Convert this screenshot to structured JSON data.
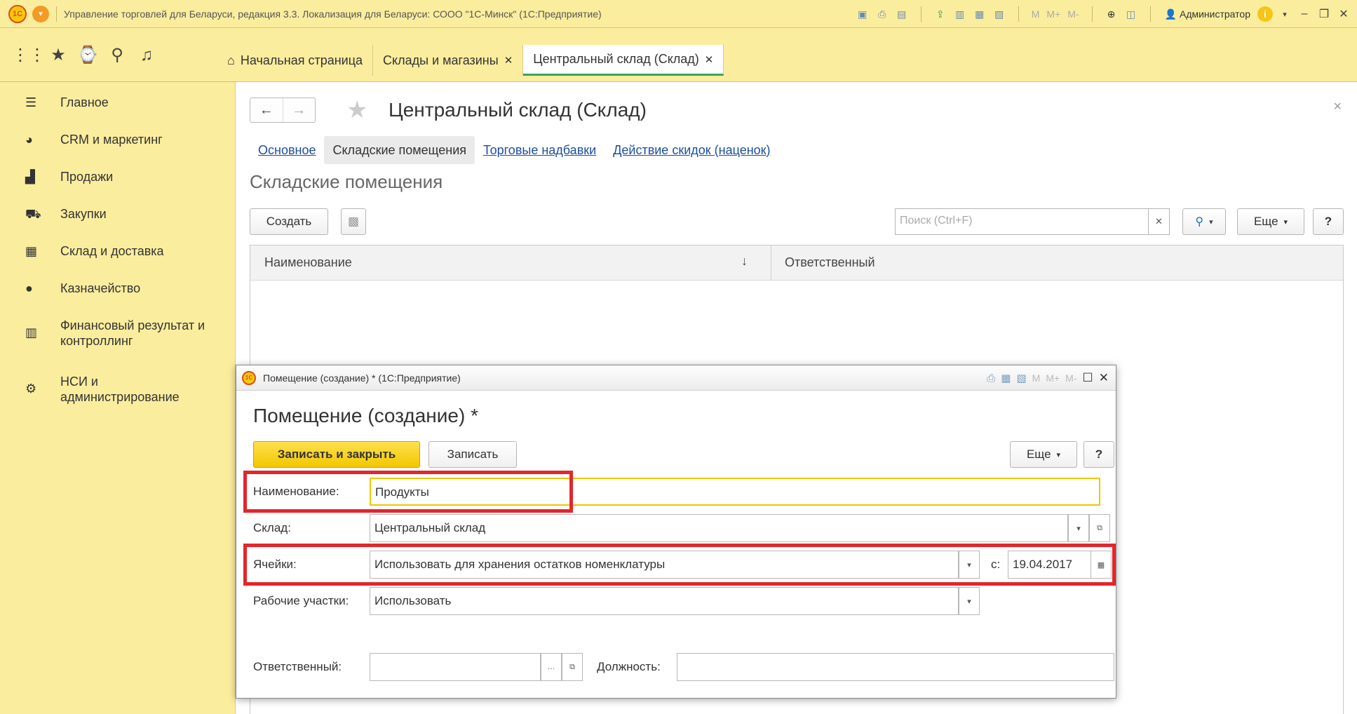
{
  "titlebar": {
    "app_title": "Управление торговлей для Беларуси, редакция 3.3. Локализация для Беларуси: СООО \"1С-Минск\" (1С:Предприятие)",
    "logo_text": "1С",
    "m_label": "M",
    "mplus_label": "M+",
    "mminus_label": "M-",
    "user": "Администратор"
  },
  "tabs": [
    {
      "label": "Начальная страница"
    },
    {
      "label": "Склады и магазины"
    },
    {
      "label": "Центральный склад (Склад)"
    }
  ],
  "sidebar": {
    "items": [
      {
        "label": "Главное"
      },
      {
        "label": "CRM и маркетинг"
      },
      {
        "label": "Продажи"
      },
      {
        "label": "Закупки"
      },
      {
        "label": "Склад и доставка"
      },
      {
        "label": "Казначейство"
      },
      {
        "label_line1": "Финансовый результат и",
        "label_line2": "контроллинг"
      },
      {
        "label_line1": "НСИ и",
        "label_line2": "администрирование"
      }
    ]
  },
  "form": {
    "title": "Центральный склад (Склад)",
    "links": [
      "Основное",
      "Складские помещения",
      "Торговые надбавки",
      "Действие скидок (наценок)"
    ],
    "section_title": "Складские помещения",
    "create_button": "Создать",
    "search_placeholder": "Поиск (Ctrl+F)",
    "more_button": "Еще",
    "help_button": "?",
    "columns": [
      "Наименование",
      "Ответственный"
    ]
  },
  "dialog": {
    "window_title": "Помещение (создание) * (1С:Предприятие)",
    "heading": "Помещение (создание) *",
    "save_close_button": "Записать и закрыть",
    "save_button": "Записать",
    "more_button": "Еще",
    "help_button": "?",
    "fields": {
      "name_label": "Наименование:",
      "name_value": "Продукты",
      "warehouse_label": "Склад:",
      "warehouse_value": "Центральный склад",
      "cells_label": "Ячейки:",
      "cells_value": "Использовать для хранения остатков номенклатуры",
      "date_prefix": "с:",
      "date_value": "19.04.2017",
      "workareas_label": "Рабочие участки:",
      "workareas_value": "Использовать",
      "responsible_label": "Ответственный:",
      "responsible_value": "",
      "position_label": "Должность:",
      "position_value": ""
    }
  },
  "colors": {
    "panel_yellow": "#fbed9e",
    "accent_yellow": "#f2c700",
    "highlight_red": "#e3262b",
    "link_blue": "#1c4fa0",
    "active_tab_green": "#3aa35b"
  }
}
